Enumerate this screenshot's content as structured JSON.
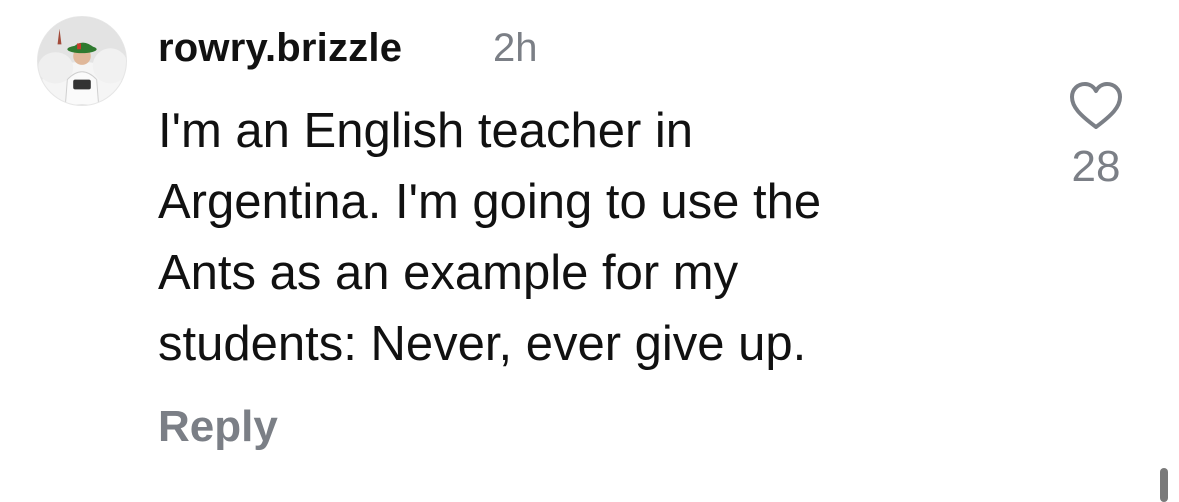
{
  "comment": {
    "username": "rowry.brizzle",
    "time": "2h",
    "text_lines": [
      "I'm an English teacher in",
      "Argentina. I'm going to use the",
      "Ants as an example for my",
      "students: Never, ever give up."
    ],
    "reply_label": "Reply",
    "like_count": "28",
    "icons": {
      "like": "heart-outline-icon"
    }
  },
  "colors": {
    "text": "#111111",
    "secondary": "#7b7f86",
    "background": "#ffffff"
  }
}
